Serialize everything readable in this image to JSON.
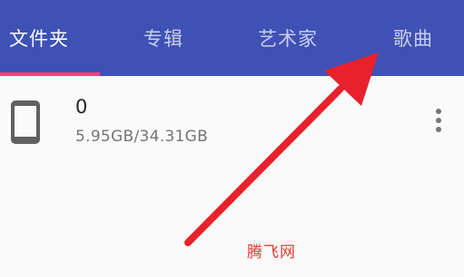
{
  "tabs": [
    {
      "label": "文件夹",
      "active": true
    },
    {
      "label": "专辑",
      "active": false
    },
    {
      "label": "艺术家",
      "active": false
    },
    {
      "label": "歌曲",
      "active": false
    }
  ],
  "storage_item": {
    "icon": "phone-icon",
    "title": "0",
    "subtitle": "5.95GB/34.31GB",
    "menu_icon": "more-vert-icon"
  },
  "overlay": {
    "arrow_color": "#e8212a",
    "watermark": "腾飞网"
  },
  "colors": {
    "toolbar": "#3f51b5",
    "indicator": "#ff4081",
    "background": "#fafafa"
  }
}
